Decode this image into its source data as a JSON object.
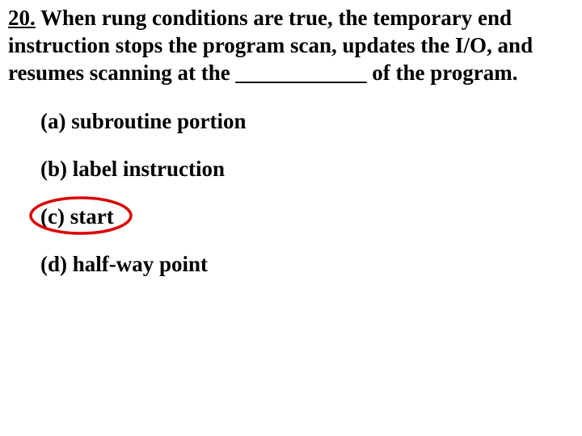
{
  "question": {
    "number": "20.",
    "text": " When rung conditions are true, the temporary end instruction stops the program scan, updates the I/O, and resumes scanning at the ____________ of the program."
  },
  "options": {
    "a": "(a) subroutine portion",
    "b": "(b) label instruction",
    "c": "(c) start",
    "d": "(d) half-way point"
  },
  "annotation": {
    "circled": "c"
  }
}
